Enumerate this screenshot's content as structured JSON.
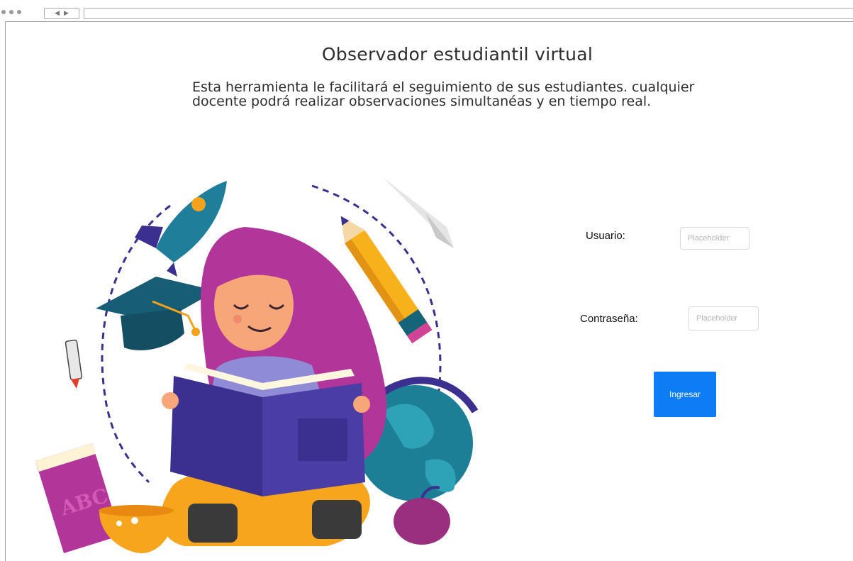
{
  "header": {
    "title": "Observador estudiantil virtual",
    "description": "Esta herramienta le facilitará el seguimiento de sus estudiantes. cualquier docente podrá realizar observaciones simultanéas y en tiempo real."
  },
  "login": {
    "user_label": "Usuario:",
    "user_placeholder": "Placeholder",
    "password_label": "Contraseña:",
    "password_placeholder": "Placeholder",
    "submit_label": "Ingresar"
  },
  "illustration": {
    "book_text": "ABC"
  },
  "colors": {
    "primary_button": "#0d7cf5",
    "hair": "#b2359a",
    "book": "#3b2f8f"
  }
}
